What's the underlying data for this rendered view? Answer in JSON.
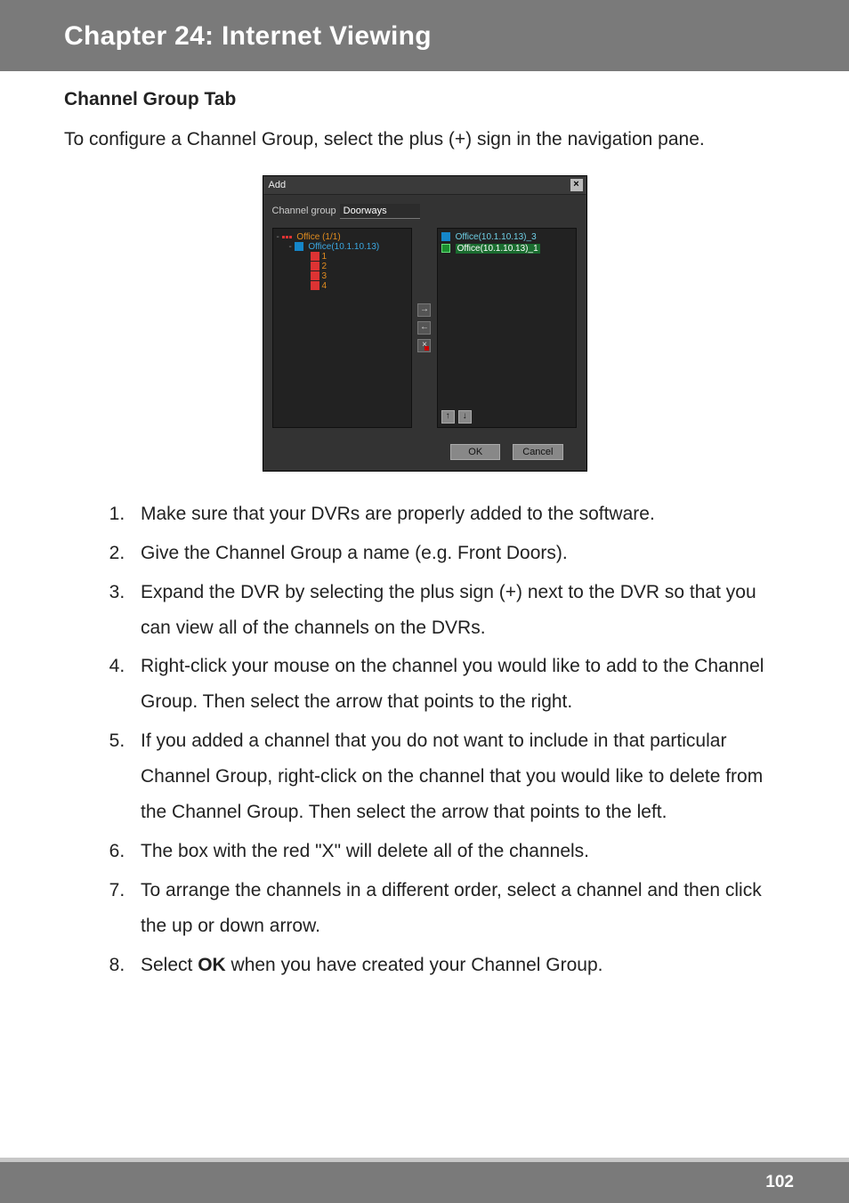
{
  "chapter_title": "Chapter 24: Internet Viewing",
  "section_title": "Channel Group Tab",
  "intro": "To configure a Channel Group, select the plus (+) sign in the navigation pane.",
  "dialog": {
    "title": "Add",
    "group_label": "Channel group",
    "group_value": "Doorways",
    "tree": {
      "root_label": "Office (1/1)",
      "dvr_label": "Office(10.1.10.13)",
      "cams": [
        "1",
        "2",
        "3",
        "4"
      ]
    },
    "selected": [
      {
        "label": "Office(10.1.10.13)_3",
        "sel": false
      },
      {
        "label": "Office(10.1.10.13)_1",
        "sel": true
      }
    ],
    "ok": "OK",
    "cancel": "Cancel"
  },
  "steps": [
    "Make sure that your DVRs are properly added to the software.",
    "Give the Channel Group a name (e.g. Front Doors).",
    "Expand the DVR by selecting the plus sign (+) next to the DVR so that you can view all of the channels on the DVRs.",
    "Right-click your mouse on the channel you would like to add to the Channel Group. Then select the arrow that points to the right.",
    "If you added a channel that you do not want to include in that particular Channel Group, right-click on the channel that you would like to delete from the Channel Group. Then select the arrow that points to the left.",
    "The box with the red \"X\" will delete all of the channels.",
    "To arrange the channels in a different order, select a channel and then click the up or down arrow."
  ],
  "step8_prefix": "Select ",
  "step8_bold": "OK",
  "step8_suffix": " when you have created your Channel Group.",
  "page_number": "102"
}
